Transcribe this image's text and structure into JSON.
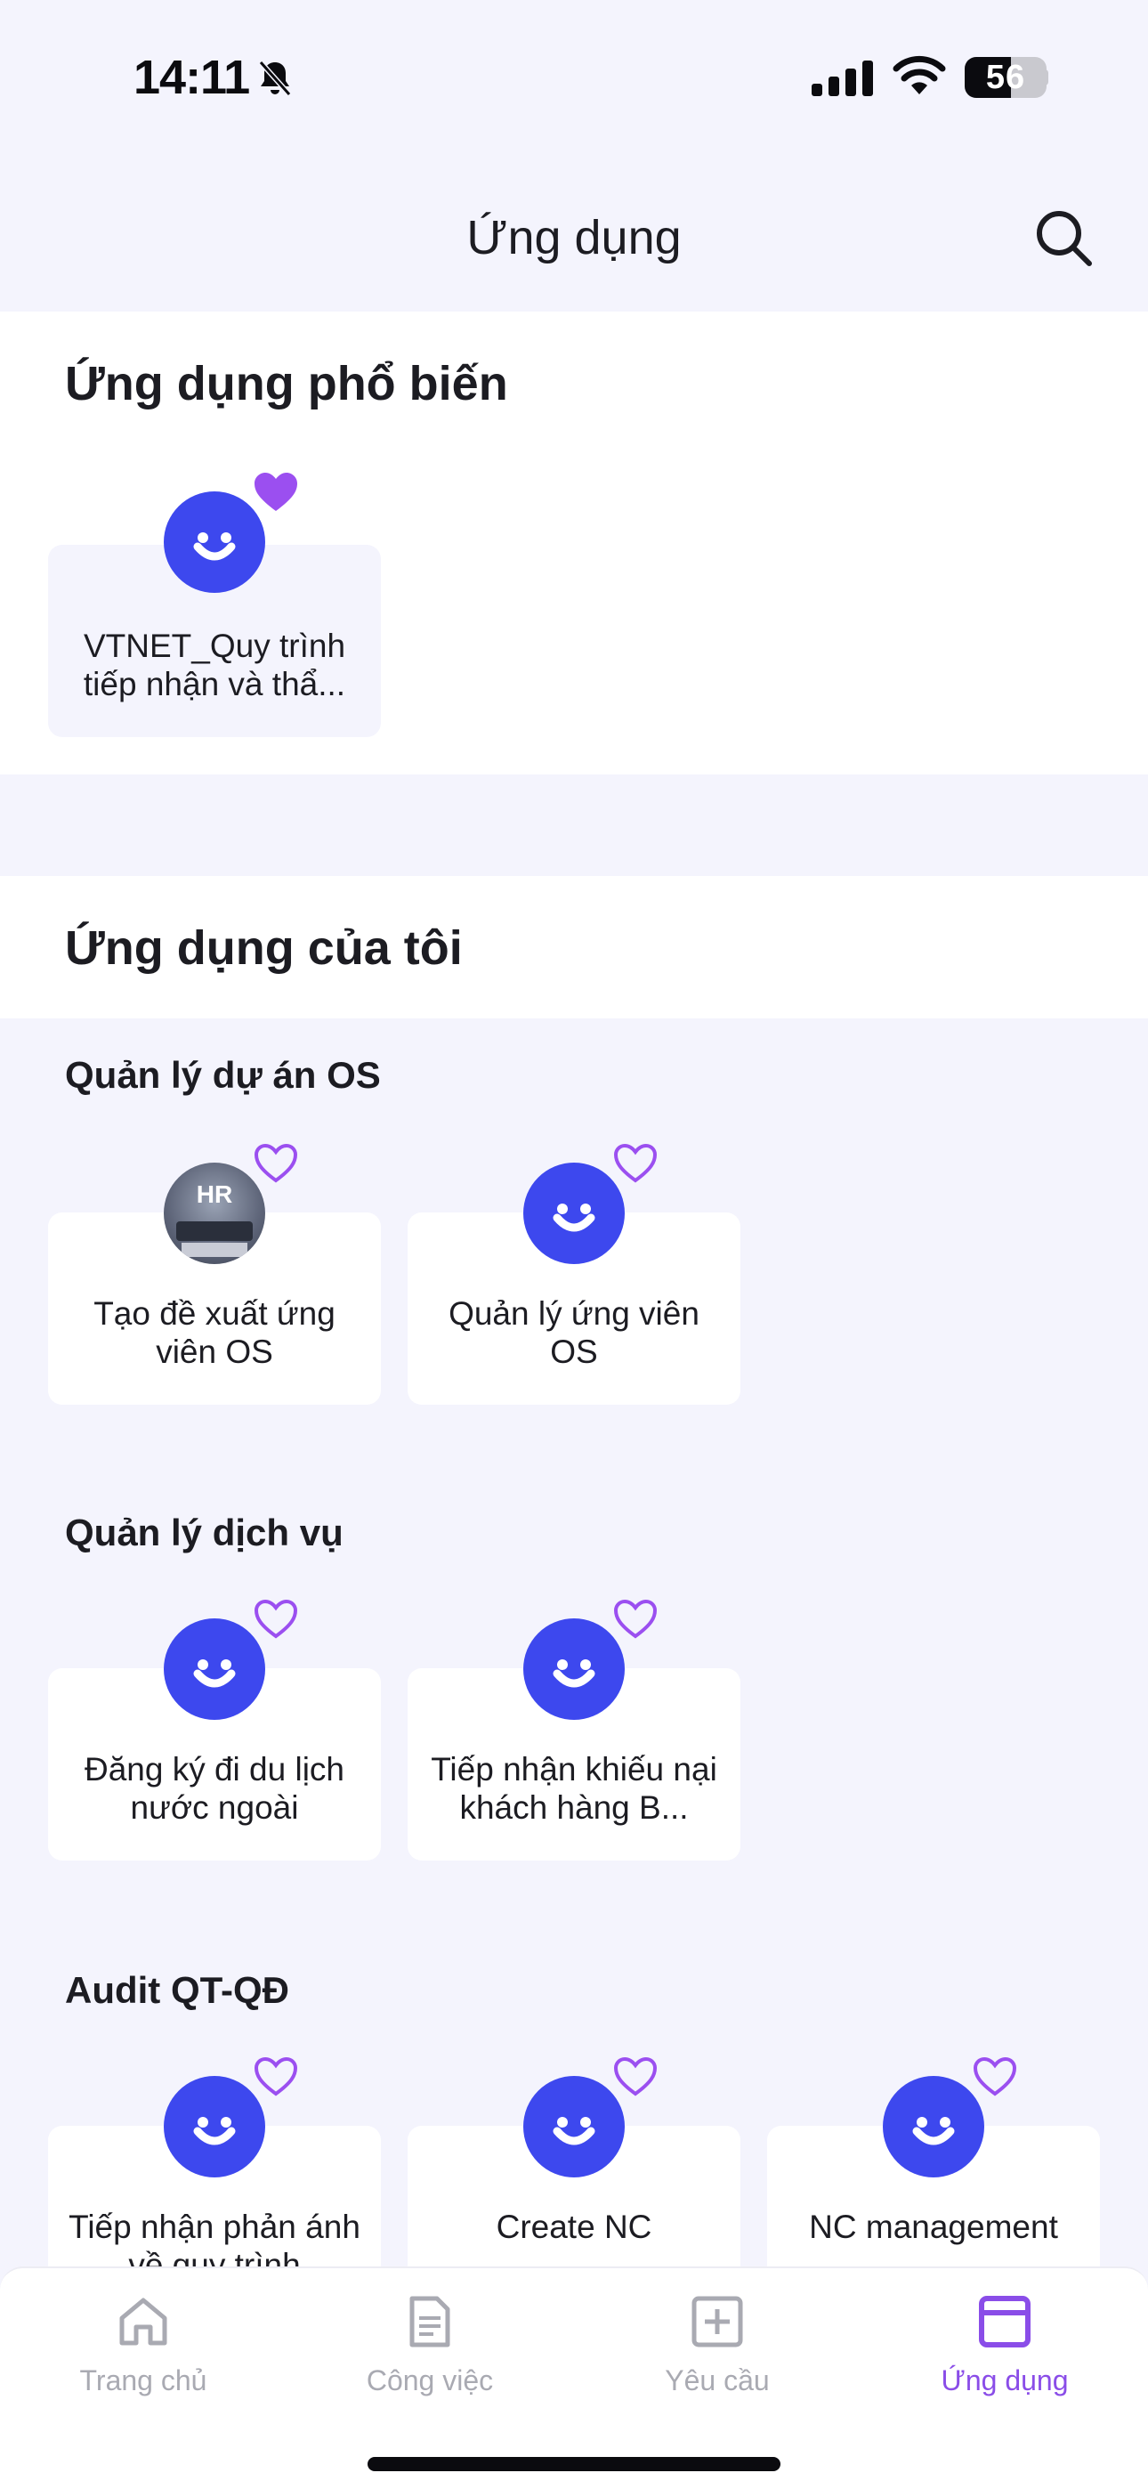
{
  "status_bar": {
    "time": "14:11",
    "battery": "56",
    "icons": [
      "bell-slash-icon",
      "cellular-signal-icon",
      "wifi-icon",
      "battery-icon"
    ]
  },
  "header": {
    "title": "Ứng dụng",
    "search_icon": "search-icon"
  },
  "popular": {
    "title": "Ứng dụng phổ biến",
    "apps": [
      {
        "label": "VTNET_Quy trình tiếp nhận và thẩ...",
        "icon": "smile-app-icon",
        "favorite": true
      }
    ]
  },
  "my_apps": {
    "title": "Ứng dụng của tôi",
    "groups": [
      {
        "title": "Quản lý dự án OS",
        "apps": [
          {
            "label": "Tạo đề xuất ứng viên OS",
            "icon": "hr-photo-icon",
            "icon_text": "HR",
            "favorite": false
          },
          {
            "label": "Quản lý ứng viên OS",
            "icon": "smile-app-icon",
            "favorite": false
          }
        ]
      },
      {
        "title": "Quản lý dịch vụ",
        "apps": [
          {
            "label": "Đăng ký đi du lịch nước ngoài",
            "icon": "smile-app-icon",
            "favorite": false
          },
          {
            "label": "Tiếp nhận khiếu nại khách hàng B...",
            "icon": "smile-app-icon",
            "favorite": false
          }
        ]
      },
      {
        "title": "Audit QT-QĐ",
        "apps": [
          {
            "label": "Tiếp nhận phản ánh về quy trình",
            "icon": "smile-app-icon",
            "favorite": false
          },
          {
            "label": "Create NC",
            "icon": "smile-app-icon",
            "favorite": false
          },
          {
            "label": "NC management",
            "icon": "smile-app-icon",
            "favorite": false
          }
        ]
      }
    ]
  },
  "bottom_nav": {
    "items": [
      {
        "label": "Trang chủ",
        "icon": "home-icon",
        "active": false
      },
      {
        "label": "Công việc",
        "icon": "document-icon",
        "active": false
      },
      {
        "label": "Yêu cầu",
        "icon": "plus-square-icon",
        "active": false
      },
      {
        "label": "Ứng dụng",
        "icon": "app-window-icon",
        "active": true
      }
    ]
  },
  "colors": {
    "background": "#f4f4fd",
    "app_icon": "#3d48ee",
    "accent": "#8a4de8",
    "inactive_nav": "#a9aab2"
  }
}
